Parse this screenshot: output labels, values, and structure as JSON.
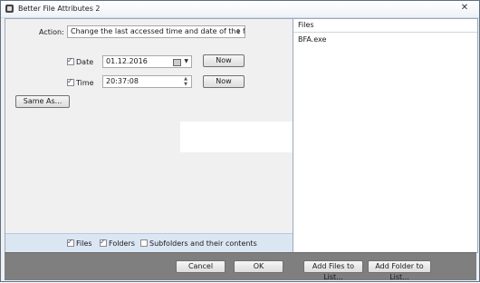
{
  "window": {
    "title": "Better File Attributes 2",
    "close_glyph": "✕"
  },
  "action": {
    "label": "Action:",
    "selected": "Change the last accessed time and date of the file(s)"
  },
  "date": {
    "label": "Date",
    "checked": true,
    "value": "01.12.2016",
    "now_label": "Now"
  },
  "time": {
    "label": "Time",
    "checked": true,
    "value": "20:37:08",
    "now_label": "Now"
  },
  "same_as_label": "Same As...",
  "filters": {
    "files_label": "Files",
    "files_checked": true,
    "folders_label": "Folders",
    "folders_checked": true,
    "subfolders_label": "Subfolders and their contents",
    "subfolders_checked": false
  },
  "files_panel": {
    "header": "Files",
    "items": [
      "BFA.exe"
    ]
  },
  "buttons": {
    "cancel": "Cancel",
    "ok": "OK",
    "add_files": "Add Files to List...",
    "add_folder": "Add Folder to List..."
  },
  "icons": {
    "app": "app-icon",
    "calendar": "calendar-icon"
  }
}
